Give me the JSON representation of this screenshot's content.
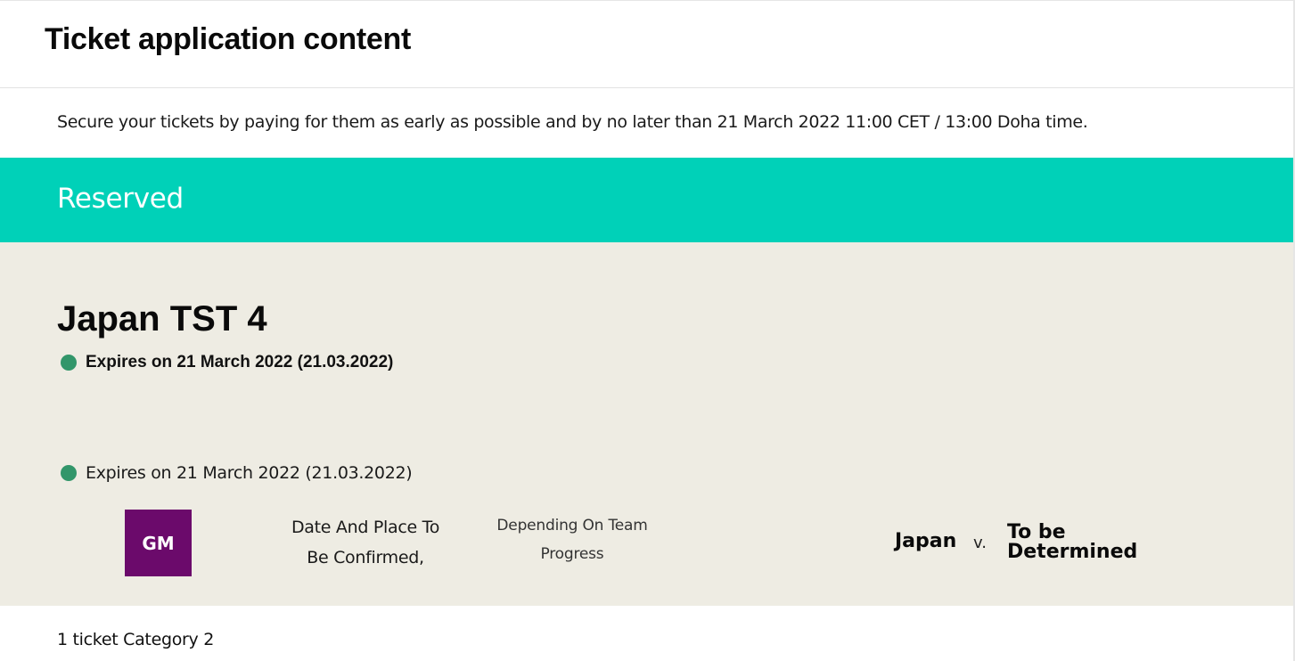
{
  "header": {
    "title": "Ticket application content"
  },
  "notice": {
    "text": "Secure your tickets by paying for them as early as possible and by no later than 21 March 2022 11:00 CET / 13:00 Doha time."
  },
  "status": {
    "label": "Reserved",
    "color": "#00d1b8"
  },
  "match": {
    "title": "Japan TST 4",
    "expiry_bold": "Expires on 21 March 2022 (21.03.2022)",
    "expiry_regular": "Expires on 21 March 2022 (21.03.2022)",
    "expiry_dot_color": "#32966a",
    "stage_badge": "GM",
    "stage_badge_color": "#6b0a6b",
    "venue_line1": "Date And Place To",
    "venue_line2": "Be Confirmed,",
    "progress_line1": "Depending On Team",
    "progress_line2": "Progress",
    "home_team": "Japan",
    "versus": "v.",
    "away_team_line1": "To be",
    "away_team_line2": "Determined",
    "panel_color": "#eeece3"
  },
  "tickets": {
    "summary": "1 ticket Category 2"
  }
}
